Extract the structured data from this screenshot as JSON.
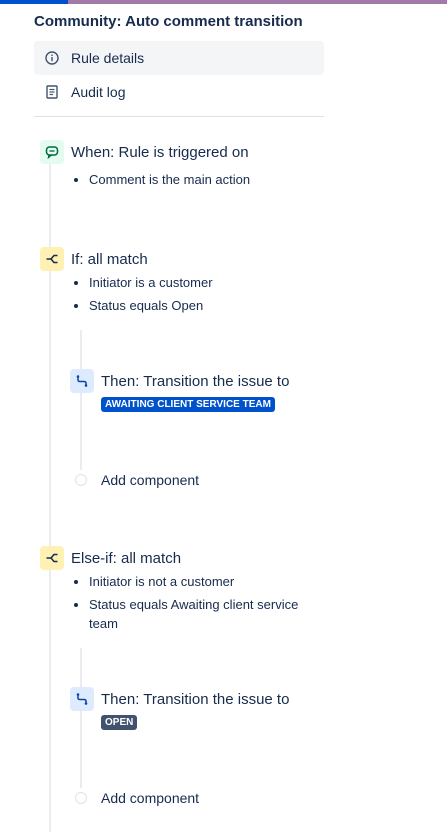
{
  "header": {
    "title": "Community: Auto comment transition"
  },
  "nav": {
    "items": [
      {
        "label": "Rule details",
        "icon": "info-icon"
      },
      {
        "label": "Audit log",
        "icon": "document-icon"
      }
    ]
  },
  "rule": {
    "trigger": {
      "title": "When: Rule is triggered on",
      "details": [
        "Comment is the main action"
      ]
    },
    "if_block": {
      "title": "If: all match",
      "conditions": [
        "Initiator is a customer",
        "Status equals Open"
      ],
      "action": {
        "title": "Then: Transition the issue to",
        "status": "AWAITING CLIENT SERVICE TEAM"
      },
      "add_label": "Add component"
    },
    "elseif_block": {
      "title": "Else-if: all match",
      "conditions": [
        "Initiator is not a customer",
        "Status equals Awaiting client service team"
      ],
      "action": {
        "title": "Then: Transition the issue to",
        "status": "OPEN"
      },
      "add_label": "Add component"
    }
  },
  "colors": {
    "accent": "#0052cc",
    "trigger_bg": "#e3fcef",
    "condition_bg": "#fff0b3",
    "action_bg": "#deebff",
    "status_blue": "#0052cc",
    "status_dark": "#42526e"
  }
}
